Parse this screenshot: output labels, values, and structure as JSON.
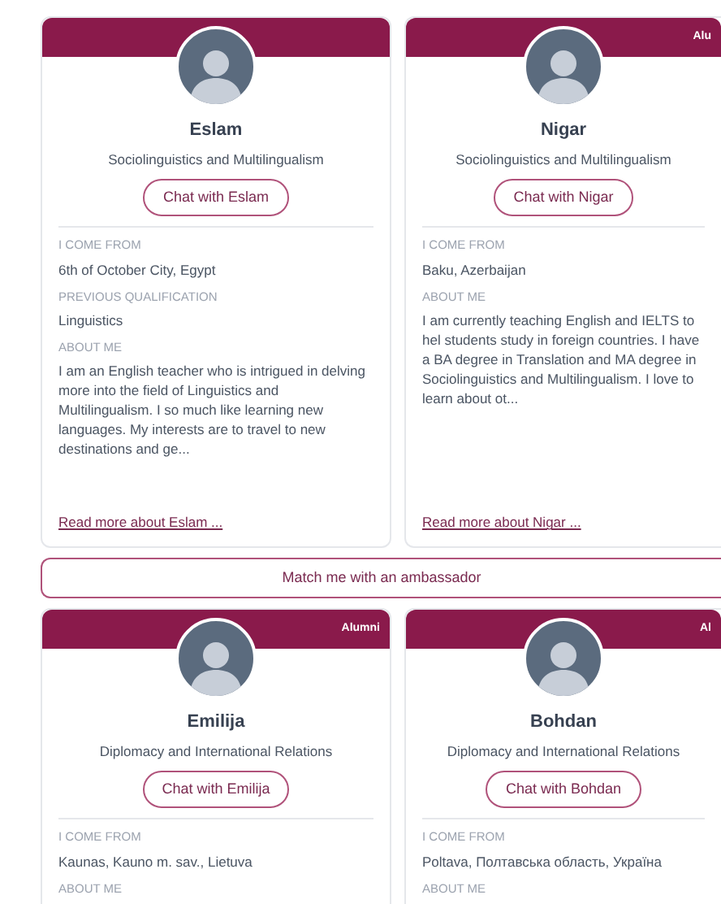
{
  "cards": [
    {
      "name": "Eslam",
      "program": "Sociolinguistics and Multilingualism",
      "chat_button": "Chat with Eslam",
      "sections": [
        {
          "label": "I COME FROM",
          "value": "6th of October City, Egypt"
        },
        {
          "label": "PREVIOUS QUALIFICATION",
          "value": "Linguistics"
        },
        {
          "label": "ABOUT ME",
          "value": "I am an English teacher who is intrigued in delving more into the field of Linguistics and Multilingualism. I so much like learning new languages. My interests are to travel to new destinations and ge..."
        }
      ],
      "read_more": "Read more about Eslam ..."
    },
    {
      "name": "Nigar",
      "badge": "Alu",
      "program": "Sociolinguistics and Multilingualism",
      "chat_button": "Chat with Nigar",
      "sections": [
        {
          "label": "I COME FROM",
          "value": "Baku, Azerbaijan"
        },
        {
          "label": "ABOUT ME",
          "value": "I am currently teaching English and IELTS to hel students study in foreign countries. I have a BA degree in Translation and MA degree in Sociolinguistics and Multilingualism. I love to learn about ot..."
        }
      ],
      "read_more": "Read more about Nigar ..."
    }
  ],
  "match_button": "Match me with an ambassador",
  "cards_row_2": [
    {
      "name": "Emilija",
      "badge": "Alumni",
      "program": "Diplomacy and International Relations",
      "chat_button": "Chat with Emilija",
      "sections": [
        {
          "label": "I COME FROM",
          "value": "Kaunas, Kauno m. sav., Lietuva"
        },
        {
          "label": "ABOUT ME"
        }
      ]
    },
    {
      "name": "Bohdan",
      "badge": "Al",
      "program": "Diplomacy and International Relations",
      "chat_button": "Chat with Bohdan",
      "sections": [
        {
          "label": "I COME FROM",
          "value": "Poltava, Полтавська область, Україна"
        },
        {
          "label": "ABOUT ME"
        }
      ]
    }
  ]
}
